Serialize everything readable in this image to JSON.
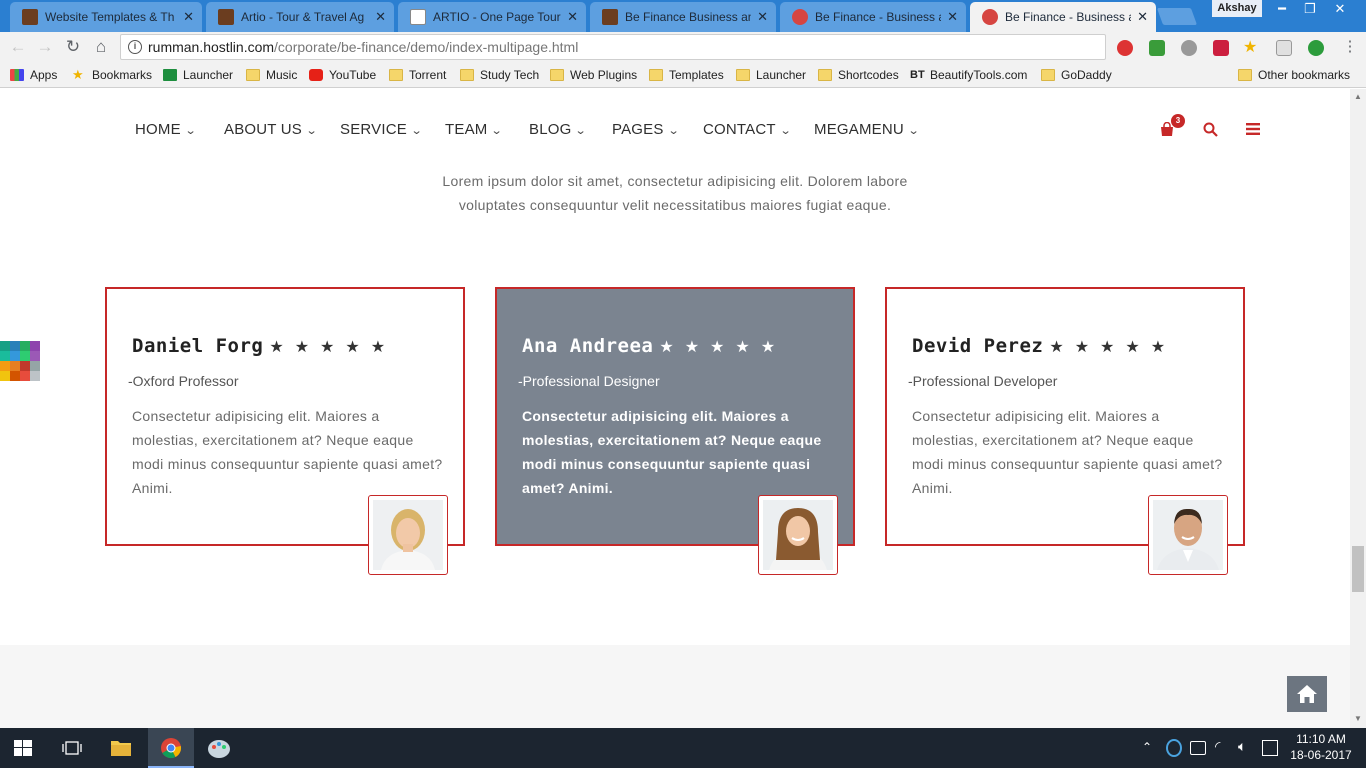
{
  "browser": {
    "tabs": [
      {
        "title": "Website Templates & Th",
        "active": false
      },
      {
        "title": "Artio - Tour & Travel Ag",
        "active": false
      },
      {
        "title": "ARTIO - One Page Tour &",
        "active": false
      },
      {
        "title": "Be Finance Business and",
        "active": false
      },
      {
        "title": "Be Finance - Business ar",
        "active": false
      },
      {
        "title": "Be Finance - Business an",
        "active": true
      }
    ],
    "profile_name": "Akshay",
    "url_host": "rumman.hostlin.com",
    "url_path": "/corporate/be-finance/demo/index-multipage.html",
    "bookmarks": [
      "Apps",
      "Bookmarks",
      "Launcher",
      "Music",
      "YouTube",
      "Torrent",
      "Study Tech",
      "Web Plugins",
      "Templates",
      "Launcher",
      "Shortcodes",
      "BeautifyTools.com",
      "GoDaddy"
    ],
    "other_bookmarks": "Other bookmarks"
  },
  "site": {
    "accent_color": "#c62828",
    "nav": [
      "HOME",
      "ABOUT US",
      "SERVICE",
      "TEAM",
      "BLOG",
      "PAGES",
      "CONTACT",
      "MEGAMENU"
    ],
    "cart_count": "3",
    "intro_line1": "Lorem ipsum dolor sit amet, consectetur adipisicing elit. Dolorem labore",
    "intro_line2": "voluptates consequuntur velit necessitatibus maiores fugiat eaque.",
    "testimonials": [
      {
        "name": "Daniel Forg",
        "rating": 5,
        "role": "-Oxford Professor",
        "quote": "Consectetur adipisicing elit. Maiores a molestias, exercitationem at? Neque eaque modi minus consequuntur sapiente quasi amet? Animi.",
        "highlighted": false
      },
      {
        "name": "Ana Andreea",
        "rating": 5,
        "role": "-Professional Designer",
        "quote": "Consectetur adipisicing elit. Maiores a molestias, exercitationem at? Neque eaque modi minus consequuntur sapiente quasi amet? Animi.",
        "highlighted": true
      },
      {
        "name": "Devid Perez",
        "rating": 5,
        "role": "-Professional Developer",
        "quote": "Consectetur adipisicing elit. Maiores a molestias, exercitationem at? Neque eaque modi minus consequuntur sapiente quasi amet? Animi.",
        "highlighted": false
      }
    ]
  },
  "taskbar": {
    "time": "11:10 AM",
    "date": "18-06-2017"
  }
}
